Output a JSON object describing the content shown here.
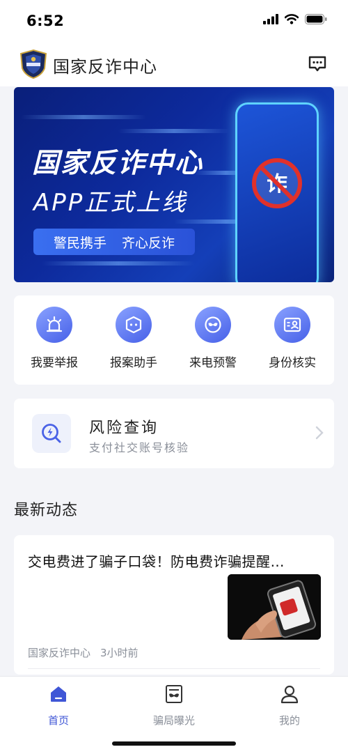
{
  "status": {
    "time": "6:52"
  },
  "app": {
    "title": "国家反诈中心"
  },
  "banner": {
    "title": "国家反诈中心",
    "subtitle": "APP正式上线",
    "slogan_left": "警民携手",
    "slogan_right": "齐心反诈",
    "sign_char": "诈"
  },
  "quick_actions": [
    {
      "label": "我要举报",
      "icon": "alarm-icon"
    },
    {
      "label": "报案助手",
      "icon": "assistant-icon"
    },
    {
      "label": "来电预警",
      "icon": "mask-icon"
    },
    {
      "label": "身份核实",
      "icon": "id-card-icon"
    }
  ],
  "risk": {
    "title": "风险查询",
    "subtitle": "支付社交账号核验"
  },
  "news_section": {
    "title": "最新动态"
  },
  "news": [
    {
      "headline": "交电费进了骗子口袋！防电费诈骗提醒…",
      "source": "国家反诈中心",
      "time": "3小时前"
    }
  ],
  "tabs": [
    {
      "label": "首页",
      "active": true
    },
    {
      "label": "骗局曝光",
      "active": false
    },
    {
      "label": "我的",
      "active": false
    }
  ],
  "colors": {
    "accent": "#3f56d6",
    "banner": "#0d2a9c",
    "danger": "#e0312b"
  }
}
